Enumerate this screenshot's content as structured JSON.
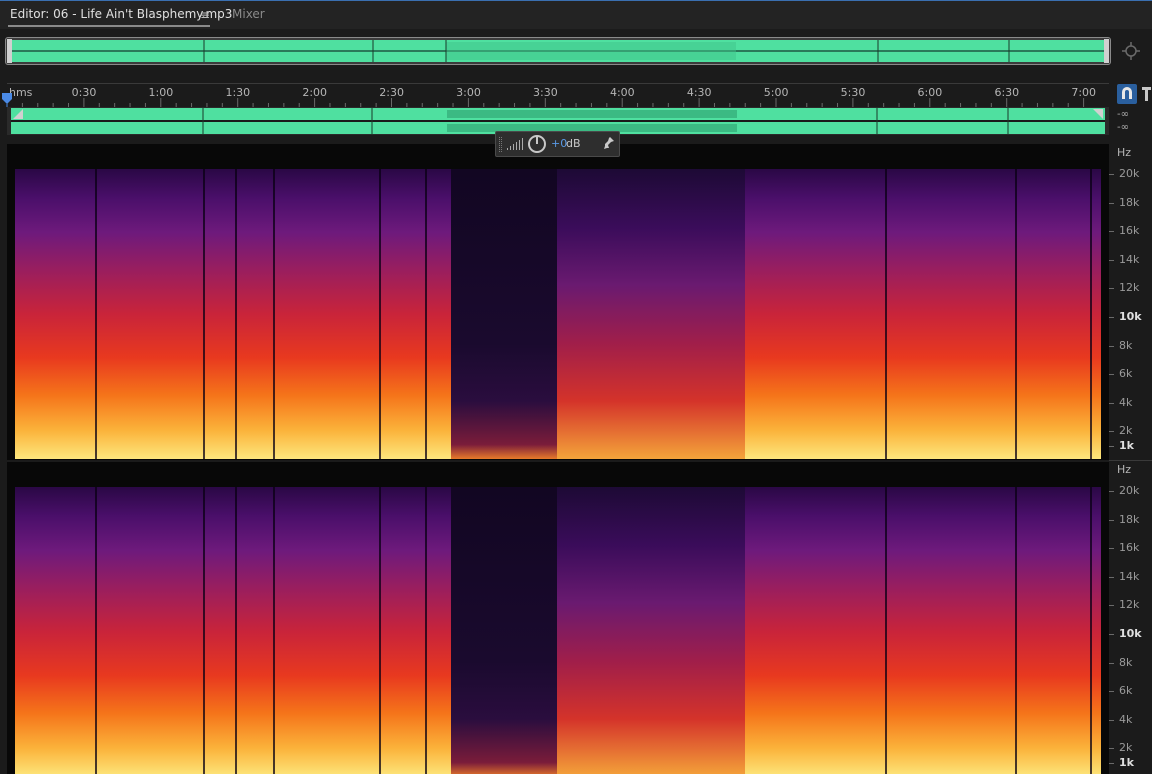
{
  "tabs": {
    "editor_label": "Editor: 06 - Life Ain't Blasphemy.mp3",
    "menu_glyph": "≡",
    "mixer_label": "Mixer"
  },
  "icons": {
    "zoom": "zoom-navigator-icon",
    "playhead": "playhead-marker-icon",
    "snap": "magnet-snap-icon",
    "pin": "pin-icon",
    "hud_pin": "pin-icon",
    "hud_knob": "volume-knob-icon",
    "hud_meter": "level-meter-icon"
  },
  "ruler": {
    "unit_label": "hms",
    "labels": [
      "0:30",
      "1:00",
      "1:30",
      "2:00",
      "2:30",
      "3:00",
      "3:30",
      "4:00",
      "4:30",
      "5:00",
      "5:30",
      "6:00",
      "6:30",
      "7:00"
    ]
  },
  "levels": {
    "top_db": "-∞",
    "bottom_db": "-∞"
  },
  "hud": {
    "value": "+0",
    "unit": "dB",
    "pin_glyph": "📌"
  },
  "frequency_scale": {
    "unit": "Hz",
    "labels": [
      "20k",
      "18k",
      "16k",
      "14k",
      "12k",
      "10k",
      "8k",
      "6k",
      "4k",
      "2k",
      "1k"
    ]
  },
  "colors": {
    "waveform": "#4fe0a0",
    "accent": "#2a5f9e",
    "hud_value": "#5a9ae6"
  }
}
